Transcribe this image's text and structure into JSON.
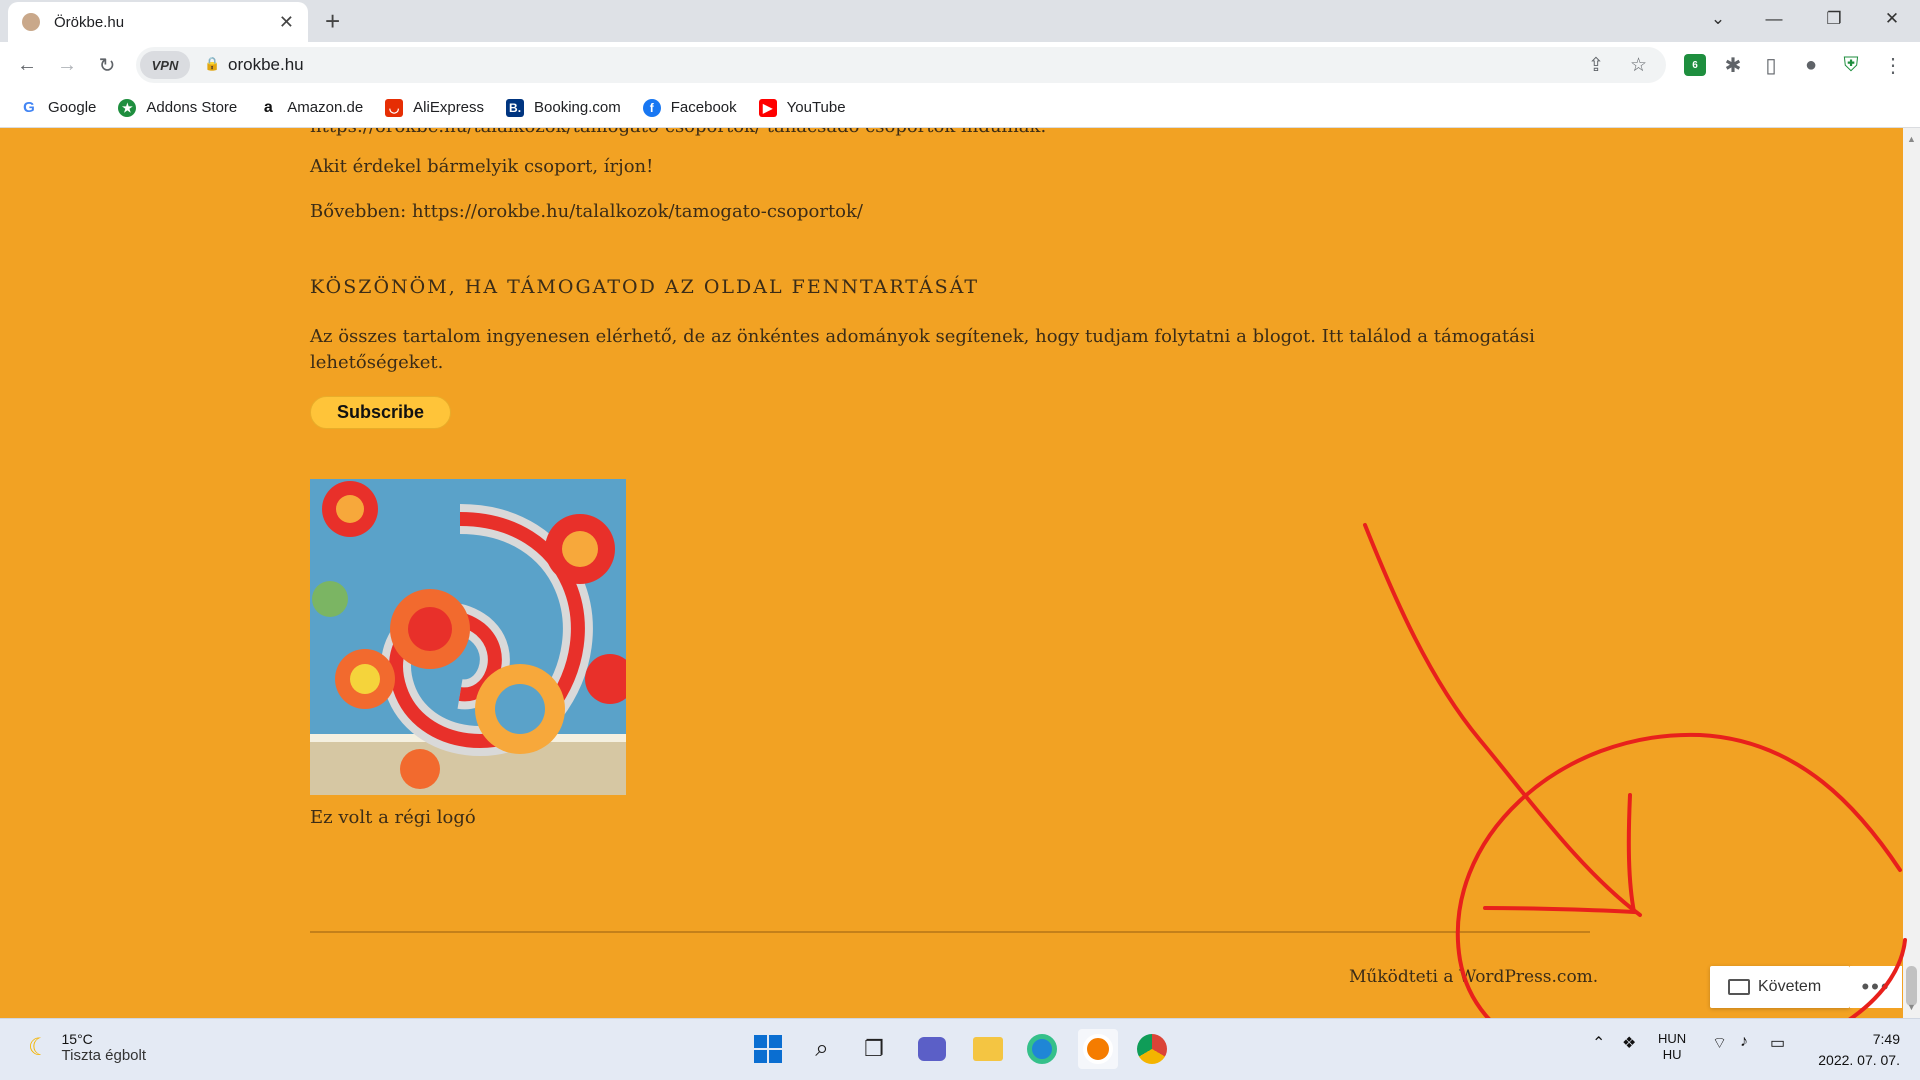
{
  "browser": {
    "tab_title": "Örökbe.hu",
    "url": "orokbe.hu",
    "vpn_label": "VPN",
    "extension_badge": "6",
    "window_controls": [
      "⌄",
      "—",
      "❐",
      "✕"
    ]
  },
  "bookmarks": [
    {
      "label": "Google",
      "icon": "google-icon",
      "color": "#4285f4"
    },
    {
      "label": "Addons Store",
      "icon": "addons-store-icon",
      "color": "#1e8e3e"
    },
    {
      "label": "Amazon.de",
      "icon": "amazon-icon",
      "color": "#111111"
    },
    {
      "label": "AliExpress",
      "icon": "aliexpress-icon",
      "color": "#e62e04"
    },
    {
      "label": "Booking.com",
      "icon": "booking-icon",
      "color": "#003580"
    },
    {
      "label": "Facebook",
      "icon": "facebook-icon",
      "color": "#1877f2"
    },
    {
      "label": "YouTube",
      "icon": "youtube-icon",
      "color": "#ff0000"
    }
  ],
  "page": {
    "partial_line": "https://orokbe.hu/talalkozok/tamogato-csoportok/ tanácsadó csoportok indulnak.",
    "contact_text": "Akit érdekel bármelyik csoport, írjon!",
    "more_info": "Bővebben: https://orokbe.hu/talalkozok/tamogato-csoportok/",
    "support_heading": "KÖSZÖNÖM, HA TÁMOGATOD AZ OLDAL FENNTARTÁSÁT",
    "support_text": "Az összes tartalom ingyenesen elérhető, de az önkéntes adományok segítenek, hogy tudjam folytatni a blogot. Itt találod a támogatási lehetőségeket.",
    "subscribe_label": "Subscribe",
    "image_caption": "Ez volt a régi logó",
    "footer_text": "Működteti a WordPress.com.",
    "follow_label": "Követem",
    "more_label": "•••",
    "accent_color": "#f2a223",
    "annotation_color": "#e8201c"
  },
  "taskbar": {
    "temperature": "15°C",
    "weather_desc": "Tiszta égbolt",
    "language": "HUN",
    "language_sub": "HU",
    "time": "7:49",
    "date": "2022. 07. 07."
  }
}
